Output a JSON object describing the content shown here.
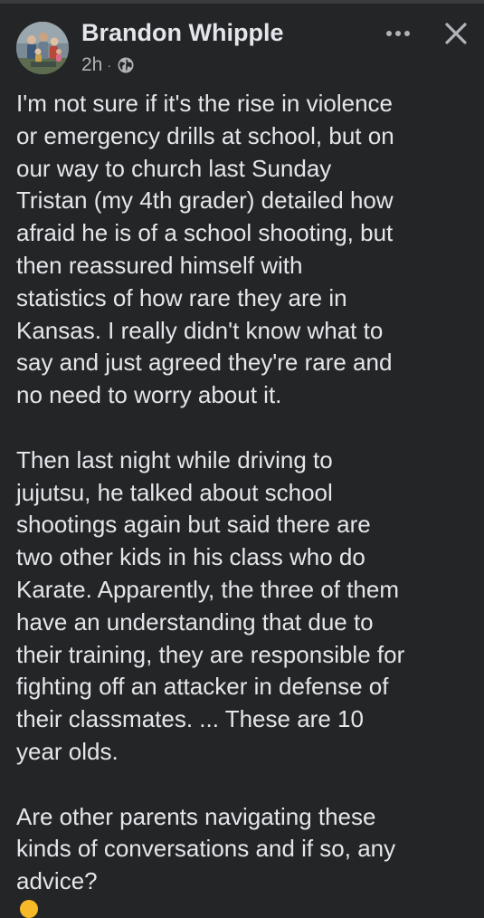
{
  "post": {
    "author": "Brandon Whipple",
    "time": "2h",
    "separator": "·",
    "privacy_icon": "globe-icon",
    "more_icon": "more-options-icon",
    "close_icon": "close-icon",
    "paragraphs": [
      [
        "I'm not sure if it's the rise in violence",
        "or emergency drills at school, but on",
        "our way to church last Sunday",
        "Tristan (my 4th grader) detailed how",
        "afraid he is of a school shooting, but",
        "then reassured himself with",
        "statistics of how rare they are in",
        "Kansas. I really didn't know what to",
        "say and just agreed they're rare and",
        "no need to worry about it."
      ],
      [
        "Then last night while driving to",
        "jujutsu, he talked about school",
        "shootings again but said there are",
        "two other kids in his class who do",
        "Karate. Apparently, the three of them",
        "have an understanding that due to",
        "their training, they are responsible for",
        "fighting off an attacker in defense of",
        "their classmates. ... These are 10",
        "year olds."
      ],
      [
        "Are other parents navigating these",
        "kinds of conversations and if so, any",
        "advice?"
      ]
    ]
  },
  "colors": {
    "background": "#242526",
    "primary_text": "#e4e6eb",
    "secondary_text": "#b0b3b8"
  }
}
